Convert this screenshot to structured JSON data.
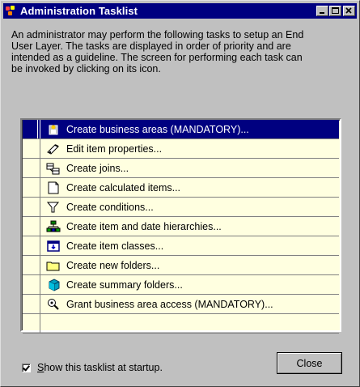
{
  "window": {
    "title": "Administration Tasklist",
    "controls": [
      "minimize-icon",
      "maximize-icon",
      "close-icon"
    ]
  },
  "intro_text": "An administrator may perform the following tasks to setup an End\nUser Layer. The tasks are displayed in order of priority and are\nintended as a guideline. The screen for performing each task can\nbe invoked by clicking on its icon.",
  "tasks": [
    {
      "label": "Create business areas (MANDATORY)...",
      "icon": "business-area-icon",
      "selected": true
    },
    {
      "label": "Edit item properties...",
      "icon": "edit-item-icon",
      "selected": false
    },
    {
      "label": "Create joins...",
      "icon": "joins-icon",
      "selected": false
    },
    {
      "label": "Create calculated items...",
      "icon": "calculated-item-icon",
      "selected": false
    },
    {
      "label": "Create conditions...",
      "icon": "condition-funnel-icon",
      "selected": false
    },
    {
      "label": "Create item and date hierarchies...",
      "icon": "hierarchy-icon",
      "selected": false
    },
    {
      "label": "Create item classes...",
      "icon": "item-class-icon",
      "selected": false
    },
    {
      "label": "Create new folders...",
      "icon": "folder-icon",
      "selected": false
    },
    {
      "label": "Create summary folders...",
      "icon": "summary-folder-icon",
      "selected": false
    },
    {
      "label": "Grant business area access (MANDATORY)...",
      "icon": "grant-access-icon",
      "selected": false
    }
  ],
  "startup_checkbox": {
    "label": "Show this tasklist at startup.",
    "checked": true
  },
  "close_button": {
    "label": "Close"
  },
  "colors": {
    "title_bar": "#000080",
    "list_background": "#ffffe0",
    "selection": "#000080",
    "dialog_face": "#c0c0c0"
  }
}
